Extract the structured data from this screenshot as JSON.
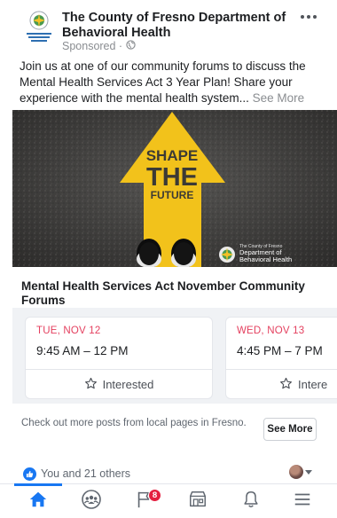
{
  "post": {
    "page_name": "The County of Fresno Department of Behavioral Health",
    "sponsored_label": "Sponsored ·",
    "more_icon": "more-horizontal-icon",
    "text": "Join us at one of our community forums to discuss the Mental Health Services Act 3 Year Plan! Share your experience with the mental health system...",
    "see_more": "See More"
  },
  "image": {
    "line1": "SHAPE",
    "line2": "THE",
    "line3": "FUTURE",
    "logo_small": "The County of Fresno",
    "logo_line1": "Department of",
    "logo_line2": "Behavioral Health"
  },
  "carousel": {
    "title": "Mental Health Services Act November Community Forums",
    "events": [
      {
        "date": "TUE, NOV 12",
        "time": "9:45 AM – 12 PM",
        "button": "Interested"
      },
      {
        "date": "WED, NOV 13",
        "time": "4:45 PM – 7 PM",
        "button": "Intere"
      }
    ]
  },
  "local": {
    "text": "Check out more posts from local pages in Fresno.",
    "button": "See More"
  },
  "reactions": {
    "text": "You and 21 others"
  },
  "tabbar": {
    "items": [
      "home-icon",
      "groups-icon",
      "pages-flag-icon",
      "marketplace-icon",
      "notifications-bell-icon",
      "menu-icon"
    ],
    "active": "home-icon",
    "pages_badge": "8"
  },
  "colors": {
    "accent": "#1877f2",
    "date_red": "#e4405f",
    "badge_red": "#e41e3f",
    "arrow_yellow": "#f2c21b"
  }
}
